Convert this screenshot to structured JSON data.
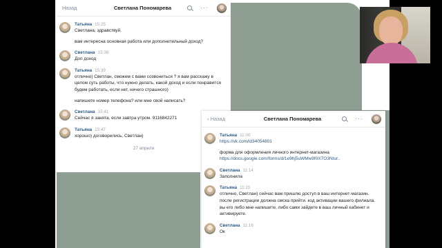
{
  "chat1": {
    "back": "Назад",
    "title": "Светлана Пономарева",
    "messages": [
      {
        "name": "Татьяна",
        "time": "15:25",
        "lines": [
          "Светлана, здравствуй.",
          "вам интересна основная работа или дополнительный доход?"
        ]
      },
      {
        "name": "Светлана",
        "time": "15:38",
        "lines": [
          "Доп доход"
        ]
      },
      {
        "name": "Татьяна",
        "time": "15:39",
        "lines": [
          "отлично) Светлан, сможем с вами созвониться ? я вам расскажу в целом суть работы, что нужно делать, какой доход и если понравится будем работать, если нет, ничего страшного)",
          "напишете номер телефона? или мне свой написать?"
        ]
      },
      {
        "name": "Светлана",
        "time": "15:41",
        "lines": [
          "Сейчас я занята, если завтра утром. 9116842271"
        ]
      },
      {
        "name": "Татьяна",
        "time": "15:47",
        "lines": [
          "хорошо) договорились, Светлан)"
        ]
      }
    ],
    "date": "27 апреля"
  },
  "chat2": {
    "back": "Назад",
    "title": "Светлана Пономарева",
    "messages": [
      {
        "name": "Татьяна",
        "time": "11:00",
        "lines": [
          "https://vk.com/id34054801",
          "форма для оформления личного интернет-магазина",
          "https://docs.google.com/forms/d/1e9hj5uWMw9f0X7O3Ntur.."
        ]
      },
      {
        "name": "Светлана",
        "time": "11:14",
        "lines": [
          "Заполнила"
        ]
      },
      {
        "name": "Татьяна",
        "time": "11:15",
        "lines": [
          "отлично, Светлан) сейчас вам пришлю доступ в ваш интернет-магазин. после регистрации должна смска прийти. код активации вашего филиала. вы его либо мне напишите, либо сами зайдете в ваш личный кабинет и активируете."
        ]
      },
      {
        "name": "Светлана",
        "time": "11:16",
        "lines": [
          "Ок"
        ]
      }
    ]
  },
  "colors": {
    "accent": "#2a5885",
    "sage": "#8e9e93",
    "muted": "#818c99"
  },
  "icons": [
    "search-icon",
    "more-icon",
    "avatar"
  ]
}
